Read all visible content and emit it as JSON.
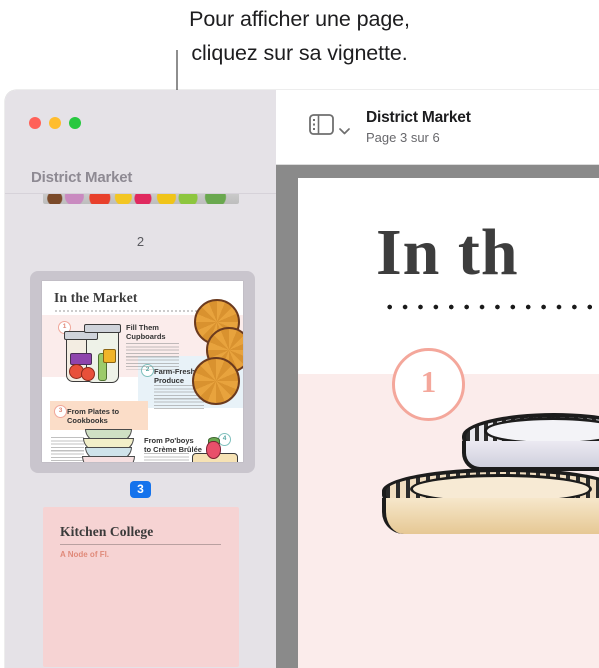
{
  "callout": {
    "line1": "Pour afficher une page,",
    "line2": "cliquez sur sa vignette.",
    "pointer": "callout-line"
  },
  "window": {
    "traffic_lights": [
      {
        "name": "close",
        "color": "#ff6159"
      },
      {
        "name": "minimize",
        "color": "#ffbd2e"
      },
      {
        "name": "zoom",
        "color": "#28c840"
      }
    ]
  },
  "sidebar": {
    "title": "District Market",
    "thumbnails": [
      {
        "page_label": "2",
        "selected": false,
        "title": ""
      },
      {
        "page_label": "3",
        "selected": true,
        "title": "In the Market"
      },
      {
        "page_label": "",
        "selected": false,
        "title": "Kitchen College"
      }
    ],
    "selected_badge": "3",
    "page_2_label": "2"
  },
  "toolbar": {
    "sidebar_toggle": "sidebar-toggle-icon",
    "chevron": "chevron-down-icon",
    "doc_title": "District Market",
    "page_status": "Page 3 sur 6"
  },
  "page_content": {
    "heading": "In th",
    "callout_number": "1",
    "thumb3": {
      "title": "In the Market",
      "sections": [
        {
          "num": "1",
          "heading_line1": "Fill Them",
          "heading_line2": "Cupboards"
        },
        {
          "num": "2",
          "heading_line1": "Farm-Fresh",
          "heading_line2": "Produce"
        },
        {
          "num": "3",
          "heading_line1": "From Plates to",
          "heading_line2": "Cookbooks"
        },
        {
          "num": "4",
          "heading_line1": "From Po'boys",
          "heading_line2": "to Crème Brûlée"
        }
      ]
    },
    "thumb4": {
      "title": "Kitchen College",
      "subtitle": "A Node of Fl."
    }
  },
  "colors": {
    "accent_blue": "#1573ec",
    "sidebar_bg": "#e5e2e7",
    "canvas_bg": "#8a8a8a",
    "page_pink": "#fbeceb",
    "circle_pink": "#f4a79b"
  }
}
